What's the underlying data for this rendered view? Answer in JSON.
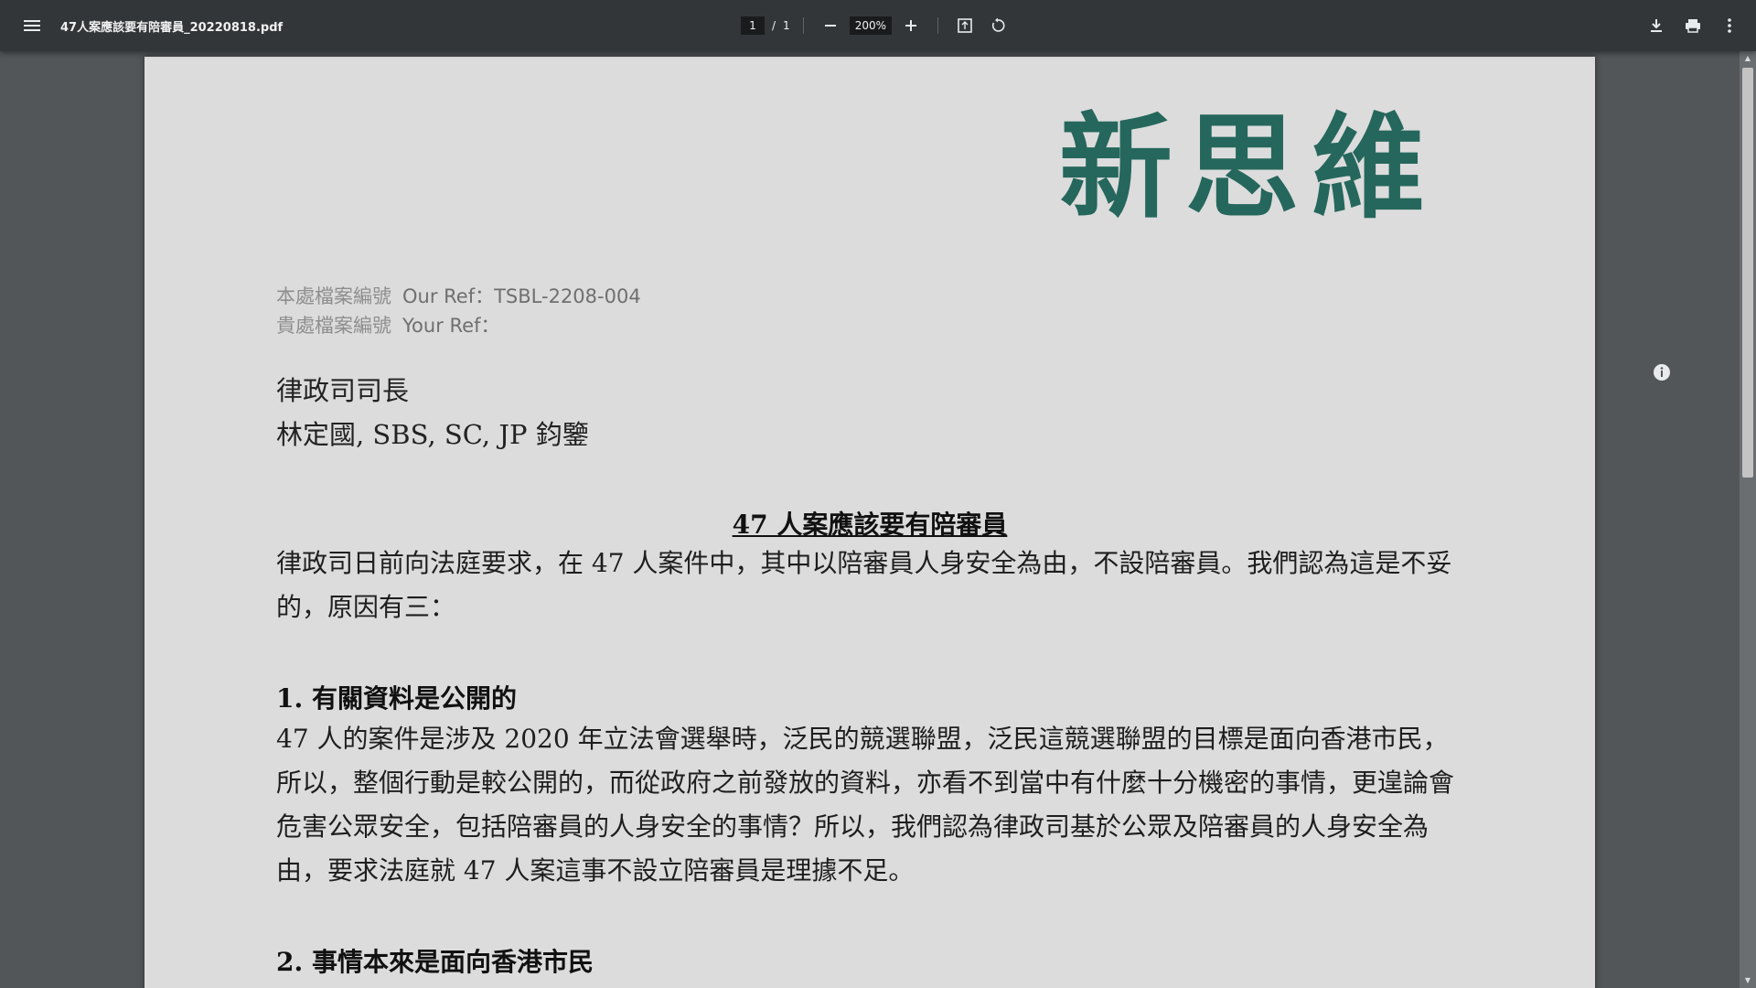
{
  "toolbar": {
    "filename": "47人案應該要有陪審員_20220818.pdf",
    "page_current": "1",
    "page_separator": "/",
    "page_total": "1",
    "zoom": "200%",
    "icons": [
      "menu-icon",
      "zoom-out-icon",
      "zoom-in-icon",
      "fit-page-icon",
      "rotate-icon",
      "download-icon",
      "print-icon",
      "more-icon"
    ]
  },
  "document": {
    "logo_text": "新思維",
    "ref_our_label": "本處檔案編號",
    "ref_our_value": "Our Ref：TSBL-2208-004",
    "ref_your_label": "貴處檔案編號",
    "ref_your_value": "Your Ref：",
    "addressee_line1": "律政司司長",
    "addressee_line2": "林定國, SBS, SC, JP  鈞鑒",
    "title": "47 人案應該要有陪審員",
    "intro": "律政司日前向法庭要求，在 47 人案件中，其中以陪審員人身安全為由，不設陪審員。我們認為這是不妥的，原因有三：",
    "section1_heading": "1.  有關資料是公開的",
    "section1_body": "47 人的案件是涉及 2020 年立法會選舉時，泛民的競選聯盟，泛民這競選聯盟的目標是面向香港市民，所以，整個行動是較公開的，而從政府之前發放的資料，亦看不到當中有什麼十分機密的事情，更遑論會危害公眾安全，包括陪審員的人身安全的事情？所以，我們認為律政司基於公眾及陪審員的人身安全為由，要求法庭就 47 人案這事不設立陪審員是理據不足。",
    "section2_heading": "2.  事情本來是面向香港市民"
  },
  "colors": {
    "toolbar_bg": "#323639",
    "viewer_bg": "#525659",
    "logo_green": "#25675c"
  }
}
